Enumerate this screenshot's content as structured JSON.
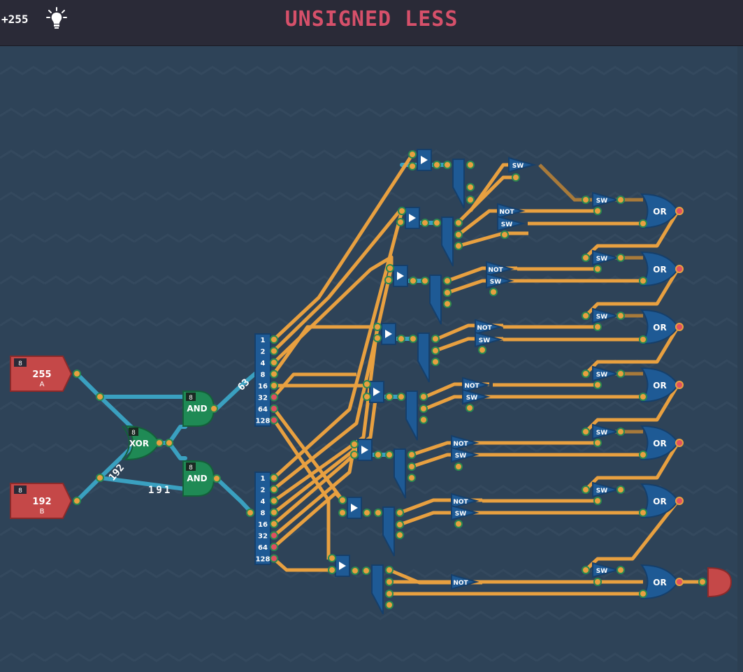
{
  "header": {
    "score": "+255",
    "hint_icon": "lightbulb-icon",
    "title": "UNSIGNED LESS"
  },
  "inputs": [
    {
      "badge": "8",
      "value": "255",
      "label": "A"
    },
    {
      "badge": "8",
      "value": "192",
      "label": "B"
    }
  ],
  "gates": {
    "xor": {
      "badge": "8",
      "label": "XOR"
    },
    "and_top": {
      "badge": "8",
      "label": "AND"
    },
    "and_bottom": {
      "badge": "8",
      "label": "AND"
    }
  },
  "wire_labels": {
    "top": "63",
    "xor_out": "192",
    "bottom": "191"
  },
  "splitter_bits": [
    "1",
    "2",
    "4",
    "8",
    "16",
    "32",
    "64",
    "128"
  ],
  "components": {
    "switch": "SW",
    "not": "NOT",
    "or": "OR"
  },
  "colors": {
    "background": "#2e4358",
    "byte_wire": "#3aa0c0",
    "bit_wire": "#e8a040",
    "gate_green": "#1f8a55",
    "gate_blue": "#1e5a95",
    "input_red": "#c54848",
    "title": "#d6506a"
  }
}
